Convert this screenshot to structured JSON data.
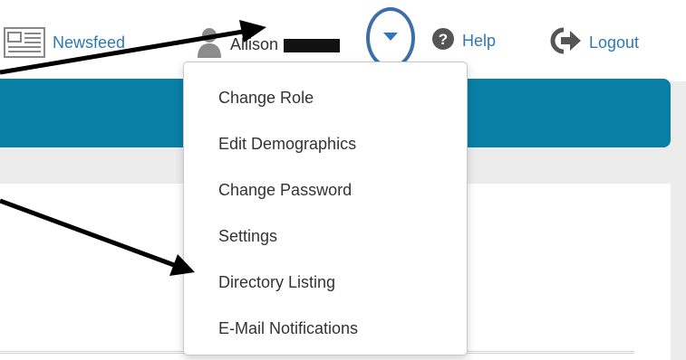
{
  "topbar": {
    "newsfeed_label": "Newsfeed",
    "user_name": "Allison",
    "help_label": "Help",
    "logout_label": "Logout"
  },
  "dropdown": {
    "items": [
      {
        "label": "Change Role"
      },
      {
        "label": "Edit Demographics"
      },
      {
        "label": "Change Password"
      },
      {
        "label": "Settings"
      },
      {
        "label": "Directory Listing"
      },
      {
        "label": "E-Mail Notifications"
      }
    ]
  },
  "icons": {
    "newsfeed": "newspaper-icon",
    "user": "user-avatar-icon",
    "caret": "caret-down-icon",
    "help": "question-circle-icon",
    "logout": "logout-icon"
  },
  "colors": {
    "link": "#2f78b5",
    "banner": "#0a7fa6",
    "highlight_circle": "#3d6ea8",
    "arrow": "#000000"
  }
}
